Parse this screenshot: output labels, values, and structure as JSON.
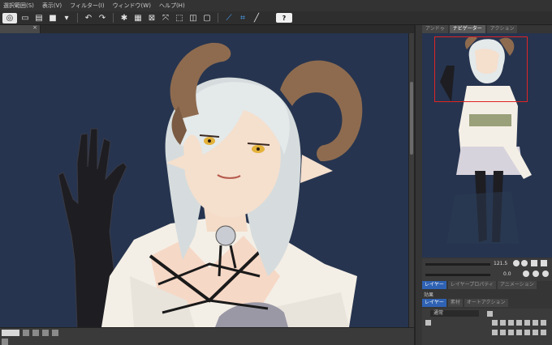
{
  "menubar": {
    "items": [
      "選択範囲(S)",
      "表示(V)",
      "フィルター(I)",
      "ウィンドウ(W)",
      "ヘルプ(H)"
    ]
  },
  "toolbar": {
    "help_label": "?"
  },
  "right_panel": {
    "top_tabs": [
      "アンドゥ",
      "ナビゲーター",
      "アクション"
    ],
    "nav_zoom": "121.5",
    "nav_angle": "0.0"
  },
  "layer_panel": {
    "tabs": [
      "レイヤー",
      "レイヤープロパティ",
      "アニメーション"
    ],
    "effect_label": "効果",
    "tabs2": [
      "レイヤー",
      "素材",
      "オートアクション"
    ],
    "blend_mode": "通常"
  },
  "colors": {
    "canvas_bg": "#26344f",
    "nav_frame": "#e02424",
    "active_tab": "#2f62b3"
  }
}
